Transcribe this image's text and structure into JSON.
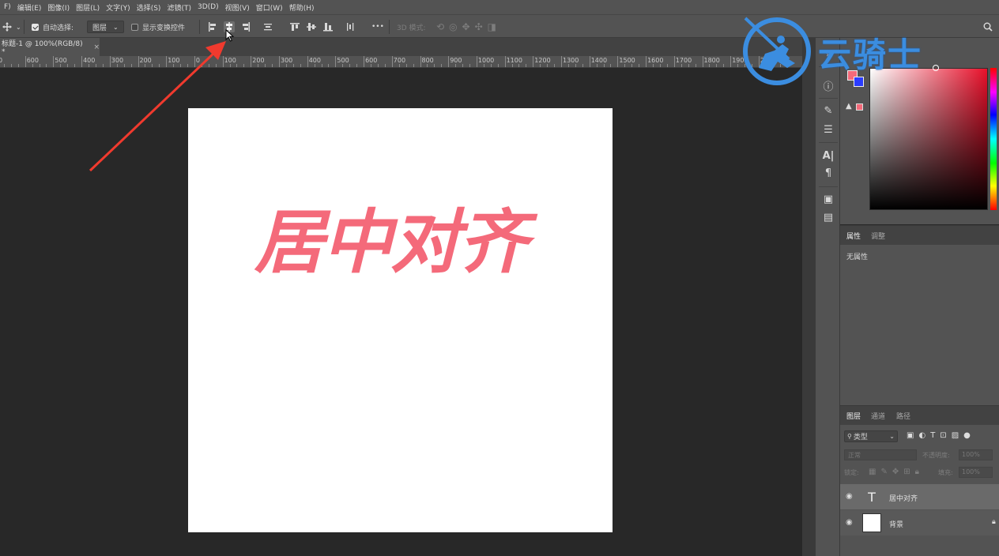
{
  "menu": [
    "F)",
    "编辑(E)",
    "图像(I)",
    "图层(L)",
    "文字(Y)",
    "选择(S)",
    "滤镜(T)",
    "3D(D)",
    "视图(V)",
    "窗口(W)",
    "帮助(H)"
  ],
  "options": {
    "auto_select_label": "自动选择:",
    "auto_select_value": "图层",
    "show_transform_label": "显示变换控件",
    "more": "•••",
    "mode_3d_label": "3D 模式:"
  },
  "document": {
    "tab_title": "标题-1 @ 100%(RGB/8) *",
    "close": "×"
  },
  "ruler_labels": [
    "0",
    "600",
    "500",
    "400",
    "300",
    "200",
    "100",
    "0",
    "100",
    "200",
    "300",
    "400",
    "500",
    "600",
    "700",
    "800",
    "900",
    "1000",
    "1100",
    "1200",
    "1300",
    "1400",
    "1500",
    "1600",
    "1700",
    "1800",
    "1900",
    "2000"
  ],
  "canvas": {
    "text": "居中对齐",
    "text_color": "#f46a7a",
    "background": "#ffffff"
  },
  "color_panel": {
    "foreground": "#f46a7a",
    "background": "#2a3cff"
  },
  "properties_panel": {
    "tabs": [
      "属性",
      "调整"
    ],
    "content": "无属性"
  },
  "layers_panel": {
    "tabs": [
      "图层",
      "通道",
      "路径"
    ],
    "filter_label": "类型",
    "blend_mode": "正常",
    "opacity_label": "不透明度:",
    "opacity_value": "100%",
    "lock_label": "锁定:",
    "fill_label": "填充:",
    "fill_value": "100%",
    "layers": [
      {
        "name": "居中对齐",
        "type": "text",
        "type_glyph": "T"
      },
      {
        "name": "背景",
        "type": "background"
      }
    ]
  },
  "watermark": {
    "text": "云骑士",
    "color": "#3b8de0"
  },
  "annotation": {
    "arrow_color": "#f03a2e"
  }
}
